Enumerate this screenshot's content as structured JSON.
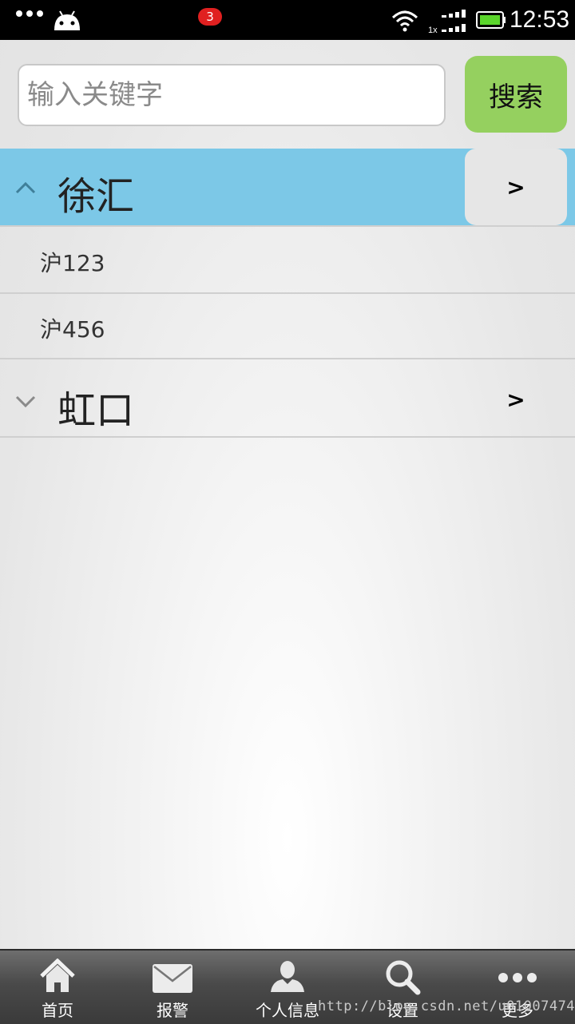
{
  "status_bar": {
    "time": "12:53",
    "network": "1x"
  },
  "search": {
    "placeholder": "输入关键字",
    "value": "",
    "button_label": "搜索"
  },
  "groups": [
    {
      "name": "徐汇",
      "expanded": true,
      "arrow": ">",
      "children": [
        "沪123",
        "沪456"
      ]
    },
    {
      "name": "虹口",
      "expanded": false,
      "arrow": ">",
      "children": []
    }
  ],
  "tabbar": {
    "items": [
      {
        "label": "首页",
        "icon": "home-icon"
      },
      {
        "label": "报警",
        "icon": "mail-icon",
        "badge": "3"
      },
      {
        "label": "个人信息",
        "icon": "user-icon"
      },
      {
        "label": "设置",
        "icon": "search-icon"
      },
      {
        "label": "更多",
        "icon": "more-icon"
      }
    ]
  },
  "watermark": "http://blog.csdn.net/u010074743",
  "colors": {
    "expanded_header": "#7cc8e7",
    "search_button": "#95d05f",
    "badge": "#e02020"
  }
}
